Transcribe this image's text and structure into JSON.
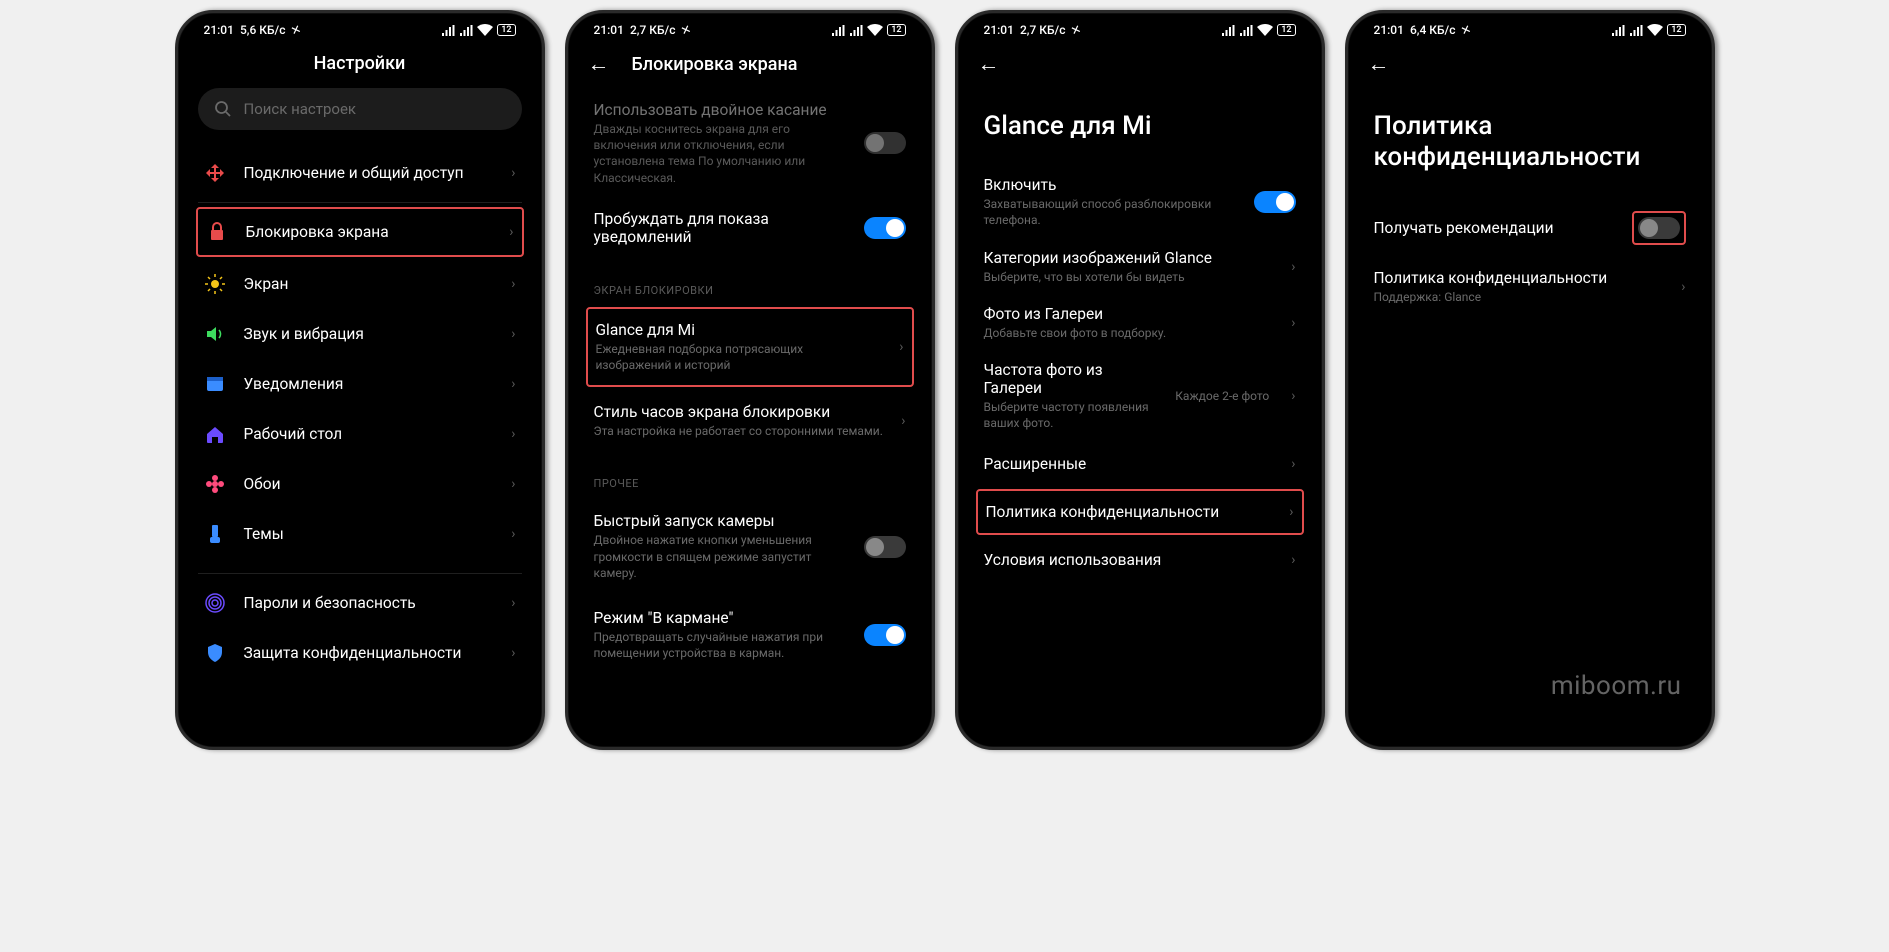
{
  "status": {
    "time": "21:01",
    "speed1": "5,6 КБ/с",
    "speed2": "2,7 КБ/с",
    "speed3": "2,7 КБ/с",
    "speed4": "6,4 КБ/с",
    "battery": "12"
  },
  "phone1": {
    "title": "Настройки",
    "search_placeholder": "Поиск настроек",
    "items": {
      "connection": "Подключение и общий доступ",
      "lockscreen": "Блокировка экрана",
      "display": "Экран",
      "sound": "Звук и вибрация",
      "notifications": "Уведомления",
      "home": "Рабочий стол",
      "wallpaper": "Обои",
      "themes": "Темы",
      "passwords": "Пароли и безопасность",
      "privacy": "Защита конфиденциальности"
    }
  },
  "phone2": {
    "title": "Блокировка экрана",
    "doubletap": {
      "label": "Использовать двойное касание",
      "sub": "Дважды коснитесь экрана для его включения или отключения, если установлена тема По умолчанию или Классическая."
    },
    "wake": {
      "label": "Пробуждать для показа уведомлений"
    },
    "section1": "ЭКРАН БЛОКИРОВКИ",
    "glance": {
      "label": "Glance для Mi",
      "sub": "Ежедневная подборка потрясающих изображений и историй"
    },
    "clockstyle": {
      "label": "Стиль часов экрана блокировки",
      "sub": "Эта настройка не работает со сторонними темами."
    },
    "section2": "ПРОЧЕЕ",
    "camera": {
      "label": "Быстрый запуск камеры",
      "sub": "Двойное нажатие кнопки уменьшения громкости в спящем режиме запустит камеру."
    },
    "pocket": {
      "label": "Режим \"В кармане\"",
      "sub": "Предотвращать случайные нажатия при помещении устройства в карман."
    }
  },
  "phone3": {
    "title": "Glance для Mi",
    "enable": {
      "label": "Включить",
      "sub": "Захватывающий способ разблокировки телефона."
    },
    "categories": {
      "label": "Категории изображений Glance",
      "sub": "Выберите, что вы хотели бы видеть"
    },
    "gallery": {
      "label": "Фото из Галереи",
      "sub": "Добавьте свои фото в подборку."
    },
    "frequency": {
      "label": "Частота фото из Галереи",
      "sub": "Выберите частоту появления ваших фото.",
      "value": "Каждое 2-е фото"
    },
    "advanced": "Расширенные",
    "privacy": "Политика конфиденциальности",
    "terms": "Условия использования"
  },
  "phone4": {
    "title": "Политика конфиденциальности",
    "recommend": "Получать рекомендации",
    "privacy": {
      "label": "Политика конфиденциальности",
      "sub": "Поддержка: Glance"
    }
  },
  "watermark": "miboom.ru"
}
